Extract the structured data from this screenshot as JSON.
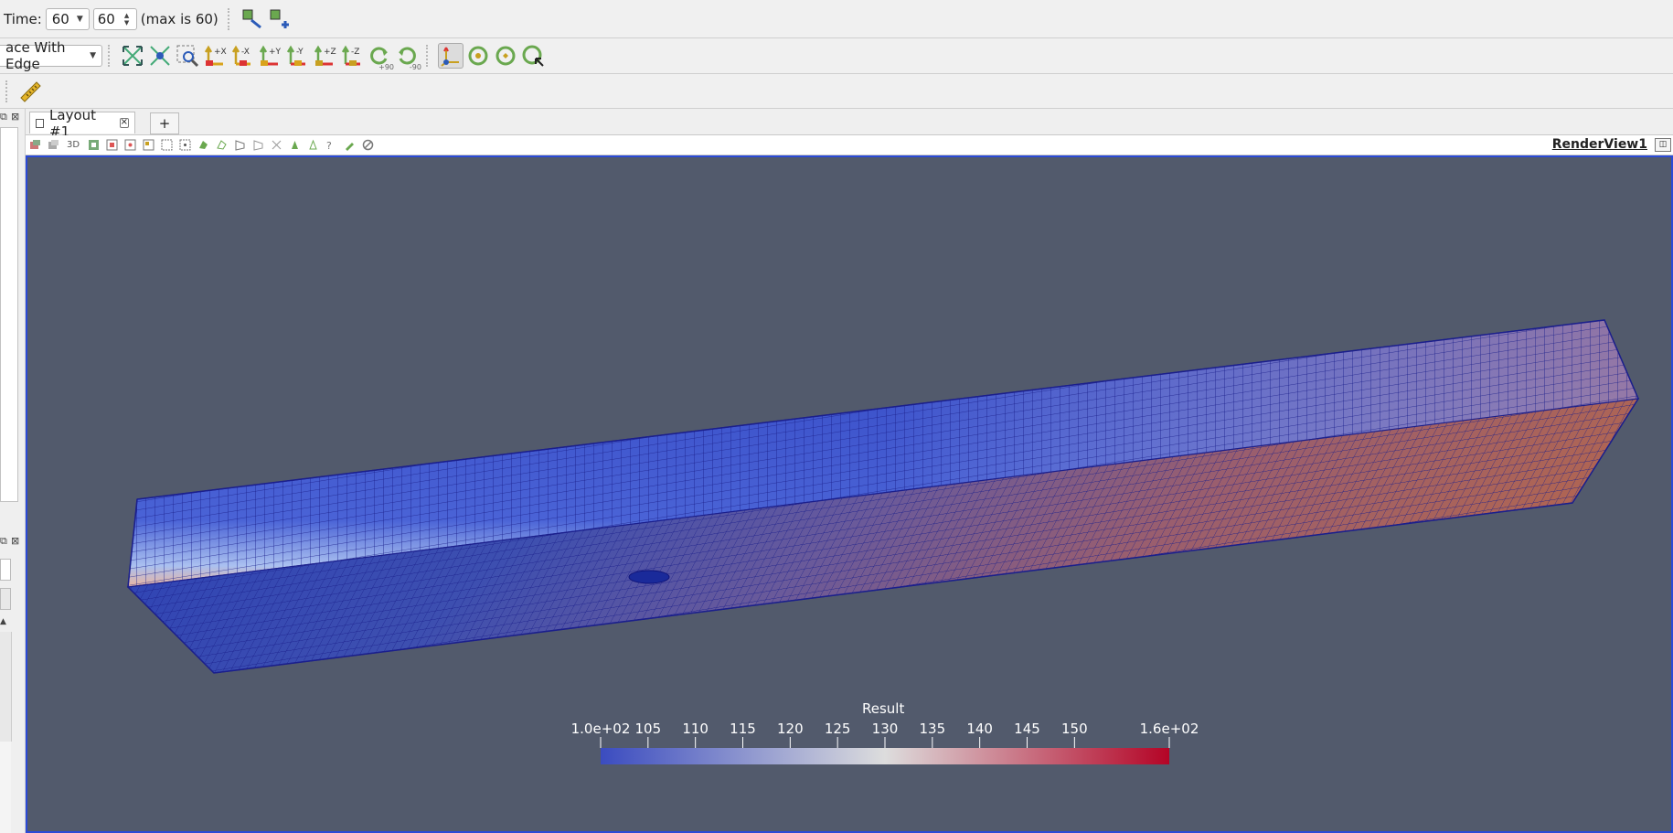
{
  "time_toolbar": {
    "label": "Time:",
    "time_value": "60",
    "step_value": "60",
    "max_text": "(max is 60)"
  },
  "camera_toolbar": {
    "representation": "ace With Edge",
    "buttons": [
      {
        "name": "reset-camera",
        "label": ""
      },
      {
        "name": "zoom-to-data",
        "label": ""
      },
      {
        "name": "zoom-to-box",
        "label": ""
      },
      {
        "name": "view-plus-x",
        "label": "+X"
      },
      {
        "name": "view-minus-x",
        "label": "-X"
      },
      {
        "name": "view-plus-y",
        "label": "+Y"
      },
      {
        "name": "view-minus-y",
        "label": "-Y"
      },
      {
        "name": "view-plus-z",
        "label": "+Z"
      },
      {
        "name": "view-minus-z",
        "label": "-Z"
      },
      {
        "name": "rotate-plus-90",
        "label": "+90"
      },
      {
        "name": "rotate-minus-90",
        "label": "-90"
      }
    ]
  },
  "layout": {
    "tab_label": "Layout #1",
    "add_tab": "+",
    "view_name": "RenderView1",
    "mode_3d": "3D"
  },
  "colorbar": {
    "title": "Result",
    "min": 100,
    "max": 160,
    "ticks": [
      "1.0e+02",
      "105",
      "110",
      "115",
      "120",
      "125",
      "130",
      "135",
      "140",
      "145",
      "150",
      "1.6e+02"
    ],
    "tick_values": [
      100,
      105,
      110,
      115,
      120,
      125,
      130,
      135,
      140,
      145,
      150,
      160
    ],
    "color_low": "#3b4cc0",
    "color_mid": "#dddddd",
    "color_high": "#b40426"
  },
  "colors": {
    "background": "#525a6c",
    "view_border": "#2b4ad6",
    "mesh_edge": "#1b1f8c"
  }
}
